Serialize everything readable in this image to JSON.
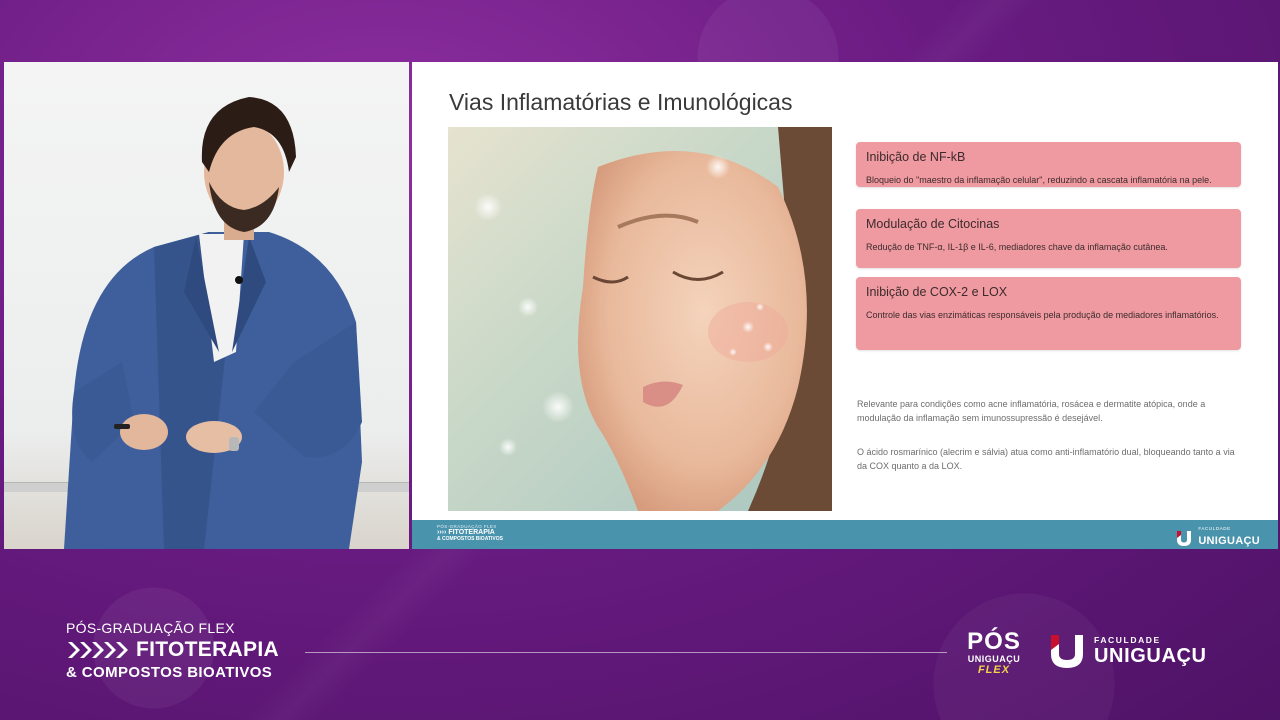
{
  "slide": {
    "title": "Vias Inflamatórias e Imunológicas",
    "cards": [
      {
        "title": "Inibição de NF-kB",
        "description": "Bloqueio do \"maestro da inflamação celular\", reduzindo a cascata inflamatória na pele."
      },
      {
        "title": "Modulação de Citocinas",
        "description": "Redução de TNF-α, IL-1β e IL-6, mediadores chave da inflamação cutânea."
      },
      {
        "title": "Inibição de COX-2 e LOX",
        "description": "Controle das vias enzimáticas responsáveis pela produção de mediadores inflamatórios."
      }
    ],
    "paragraphs": [
      "Relevante para condições como acne inflamatória, rosácea e dermatite atópica, onde a modulação da inflamação sem imunossupressão é desejável.",
      "O ácido rosmarínico (alecrim e sálvia) atua como anti-inflamatório dual, bloqueando tanto a via da COX quanto a da LOX."
    ],
    "footer": {
      "course_top": "PÓS-GRADUAÇÃO FLEX",
      "course_main": "FITOTERAPIA",
      "course_sub": "& COMPOSTOS BIOATIVOS",
      "logo_small": "FACULDADE",
      "logo_big": "UNIGUAÇU"
    }
  },
  "branding": {
    "program_label": "PÓS-GRADUAÇÃO FLEX",
    "course_title": "FITOTERAPIA",
    "course_subtitle": "& COMPOSTOS BIOATIVOS",
    "pos_logo": {
      "big": "PÓS",
      "mid": "UNIGUAÇU",
      "flex": "FLEX"
    },
    "faculty_logo": {
      "small": "FACULDADE",
      "big": "UNIGUAÇU"
    }
  },
  "colors": {
    "background_purple": "#6a1b82",
    "card_pink": "#ef9aa0",
    "slide_footer_blue": "#4a93ad",
    "brand_red": "#c8102e",
    "flex_yellow": "#f5d24a"
  },
  "icons": {
    "arrows": "chevron-arrows-icon",
    "faculty": "uniguacu-u-logo-icon"
  }
}
